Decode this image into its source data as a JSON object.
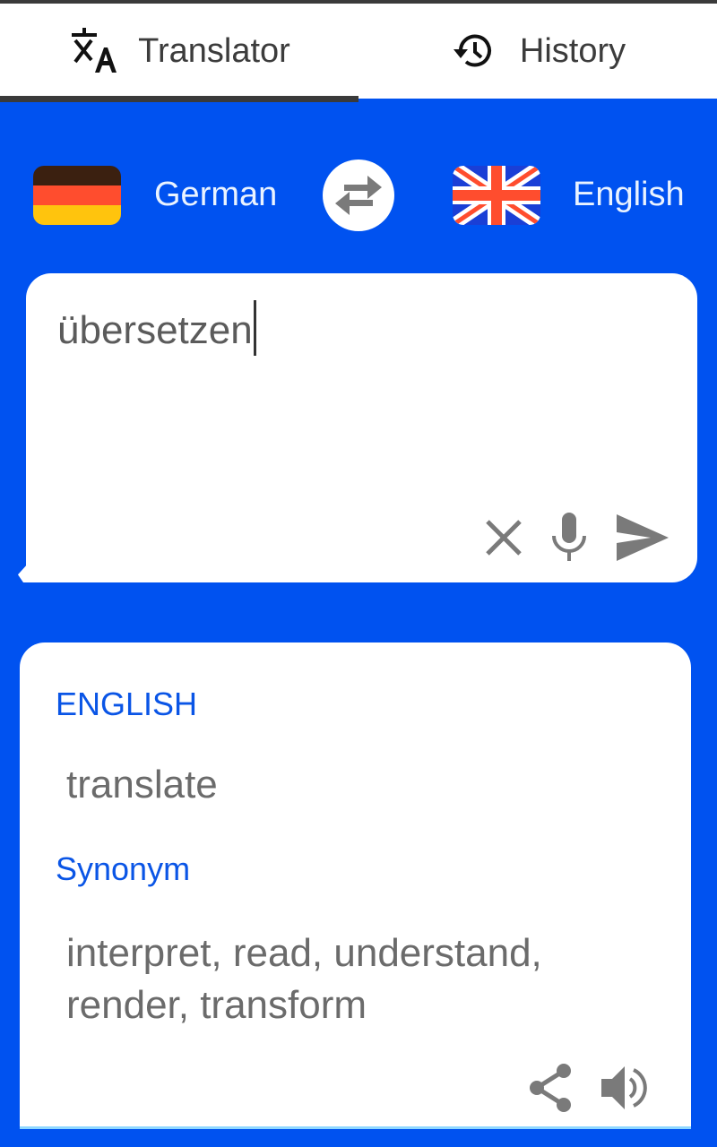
{
  "tabs": [
    {
      "label": "Translator",
      "icon": "translate-icon",
      "active": true
    },
    {
      "label": "History",
      "icon": "history-icon",
      "active": false
    }
  ],
  "languages": {
    "source": {
      "label": "German",
      "flag": "germany-flag-icon"
    },
    "target": {
      "label": "English",
      "flag": "uk-flag-icon"
    },
    "swap_icon": "swap-arrows-icon"
  },
  "input": {
    "value": "übersetzen",
    "actions": [
      "clear-icon",
      "microphone-icon",
      "send-icon"
    ]
  },
  "output": {
    "language_label": "ENGLISH",
    "translation": "translate",
    "synonym_label": "Synonym",
    "synonyms": "interpret, read, understand, render, transform",
    "actions": [
      "share-icon",
      "speaker-icon"
    ]
  },
  "colors": {
    "primary": "#0052f0",
    "accent_text": "#0a55e6",
    "icon_gray": "#7a7a7a"
  }
}
